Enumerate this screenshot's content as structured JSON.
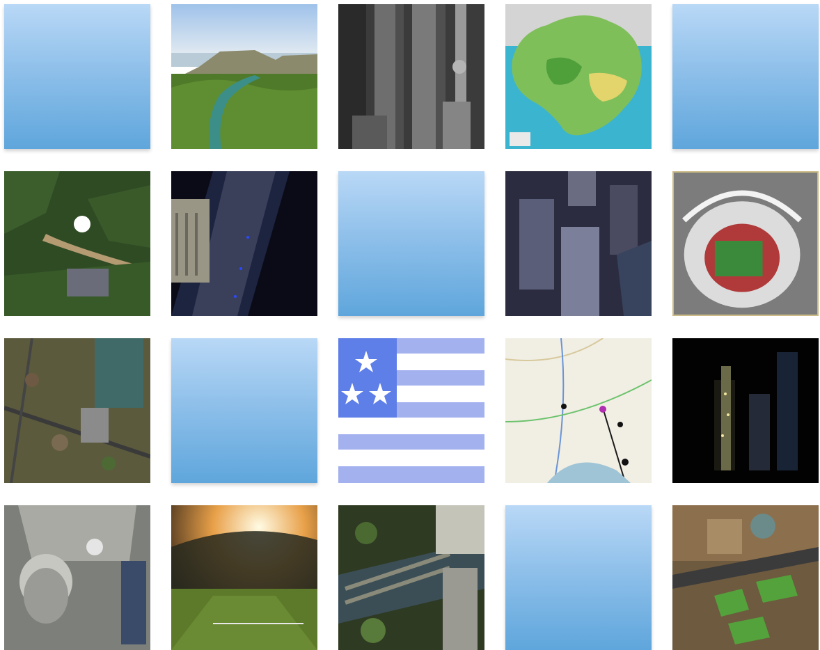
{
  "gallery": {
    "columns": 5,
    "rows": 4,
    "tiles": [
      {
        "kind": "placeholder",
        "icon": "placeholder-tile"
      },
      {
        "kind": "photo",
        "icon": "coastal-river-valley"
      },
      {
        "kind": "photo",
        "icon": "skyscraper-aerial"
      },
      {
        "kind": "map",
        "icon": "terrain-region-map"
      },
      {
        "kind": "placeholder",
        "icon": "placeholder-tile"
      },
      {
        "kind": "photo",
        "icon": "forest-observatory"
      },
      {
        "kind": "photo",
        "icon": "night-bridge"
      },
      {
        "kind": "placeholder",
        "icon": "placeholder-tile"
      },
      {
        "kind": "photo",
        "icon": "city-office-towers"
      },
      {
        "kind": "photo",
        "icon": "stadium-aerial"
      },
      {
        "kind": "photo",
        "icon": "suburb-aerial"
      },
      {
        "kind": "placeholder",
        "icon": "placeholder-tile"
      },
      {
        "kind": "flag",
        "icon": "three-star-striped-flag"
      },
      {
        "kind": "map",
        "icon": "road-route-map"
      },
      {
        "kind": "photo",
        "icon": "night-skyline"
      },
      {
        "kind": "photo",
        "icon": "beehive-building-aerial"
      },
      {
        "kind": "photo",
        "icon": "stadium-sunset-pitch"
      },
      {
        "kind": "photo",
        "icon": "city-river-bridges"
      },
      {
        "kind": "placeholder",
        "icon": "placeholder-tile"
      },
      {
        "kind": "photo",
        "icon": "town-square-aerial"
      }
    ]
  },
  "colors": {
    "placeholder_top": "#b9d8f6",
    "placeholder_bottom": "#5fa6dc",
    "flag_blue": "#5e7ee8",
    "flag_stripe": "#a3b1ef"
  }
}
